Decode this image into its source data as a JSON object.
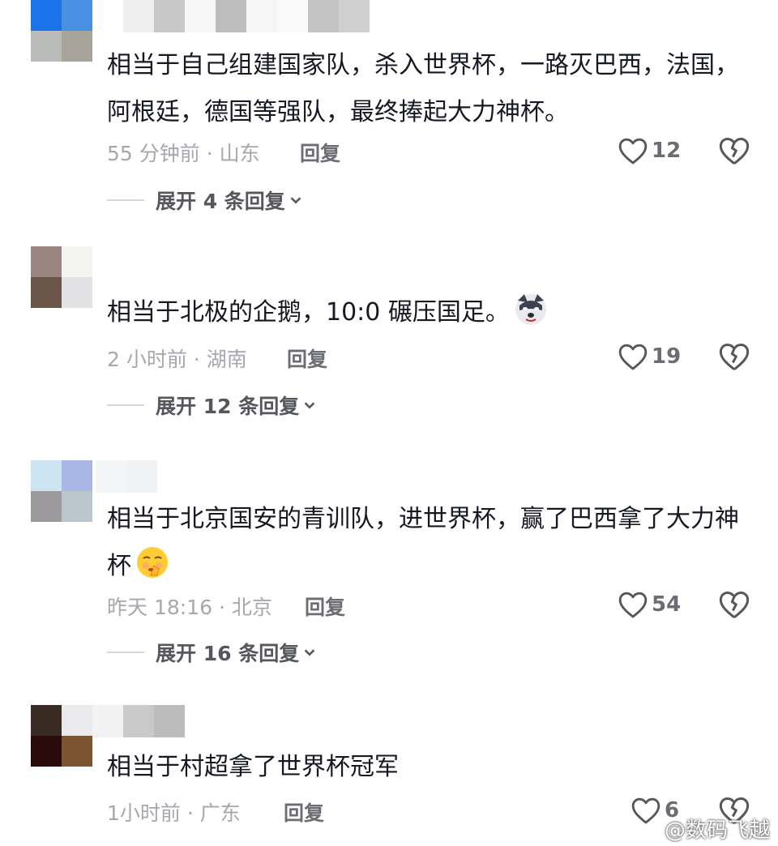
{
  "comments": [
    {
      "text": "相当于自己组建国家队，杀入世界杯，一路灭巴西，法国，阿根廷，德国等强队，最终捧起大力神杯。",
      "meta": "55 分钟前 · 山东",
      "reply_label": "回复",
      "likes": "12",
      "expand_label": "展开 4 条回复",
      "avatar_colors": [
        "#1a73e8",
        "#4a90e2",
        "#b9bbb8",
        "#a8a49b"
      ]
    },
    {
      "text": "相当于北极的企鹅，10:0  碾压国足。",
      "meta": "2 小时前 · 湖南",
      "reply_label": "回复",
      "likes": "19",
      "expand_label": "展开 12 条回复",
      "emoji": "wolf-emoji",
      "avatar_colors": [
        "#9a8580",
        "#f4f4f0",
        "#6b5448",
        "#e2e1e3"
      ]
    },
    {
      "text": "相当于北京国安的青训队，进世界杯，赢了巴西拿了大力神杯",
      "meta": "昨天 18:16 · 北京",
      "reply_label": "回复",
      "likes": "54",
      "expand_label": "展开 16 条回复",
      "emoji": "shush-emoji",
      "avatar_colors": [
        "#cde4f2",
        "#a9b7e6",
        "#9c9a9c",
        "#b9c7cc"
      ]
    },
    {
      "text": "相当于村超拿了世界杯冠军",
      "meta": "1小时前 · 广东",
      "reply_label": "回复",
      "likes": "6",
      "avatar_colors": [
        "#3a2a24",
        "#eaeaec",
        "#2a0a0a",
        "#7a5530"
      ]
    }
  ],
  "watermark": "@数码飞越",
  "icons": {
    "like": "heart-outline-icon",
    "dislike": "broken-heart-icon",
    "expand": "chevron-down-icon"
  }
}
